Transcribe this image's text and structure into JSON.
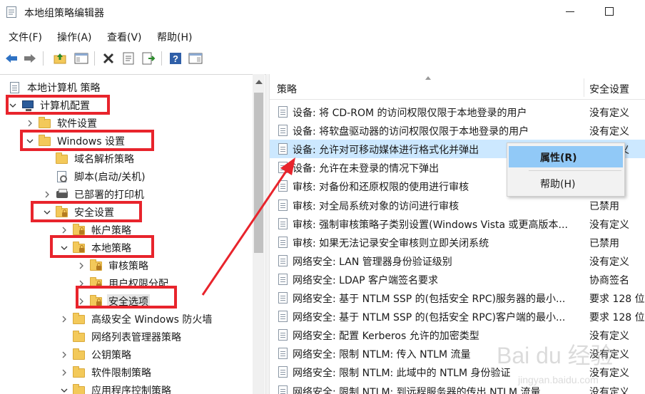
{
  "window": {
    "title": "本地组策略编辑器"
  },
  "menu": [
    "文件(F)",
    "操作(A)",
    "查看(V)",
    "帮助(H)"
  ],
  "toolbar": {
    "buttons": [
      "back-icon",
      "forward-icon",
      "up-folder-icon",
      "show-hide-tree-icon",
      "delete-icon",
      "properties-icon",
      "export-list-icon",
      "help-icon",
      "show-action-pane-icon"
    ]
  },
  "tree": {
    "items": [
      {
        "label": "本地计算机 策略",
        "icon": "document-icon"
      },
      {
        "label": "计算机配置",
        "icon": "computer-icon"
      },
      {
        "label": "软件设置",
        "icon": "folder-icon"
      },
      {
        "label": "Windows 设置",
        "icon": "folder-icon"
      },
      {
        "label": "域名解析策略",
        "icon": "folder-icon"
      },
      {
        "label": "脚本(启动/关机)",
        "icon": "script-icon"
      },
      {
        "label": "已部署的打印机",
        "icon": "printer-icon"
      },
      {
        "label": "安全设置",
        "icon": "security-folder-icon"
      },
      {
        "label": "帐户策略",
        "icon": "security-folder-icon"
      },
      {
        "label": "本地策略",
        "icon": "security-folder-icon"
      },
      {
        "label": "审核策略",
        "icon": "security-folder-icon"
      },
      {
        "label": "用户权限分配",
        "icon": "security-folder-icon"
      },
      {
        "label": "安全选项",
        "icon": "security-folder-icon"
      },
      {
        "label": "高级安全 Windows 防火墙",
        "icon": "folder-icon"
      },
      {
        "label": "网络列表管理器策略",
        "icon": "folder-icon"
      },
      {
        "label": "公钥策略",
        "icon": "folder-icon"
      },
      {
        "label": "软件限制策略",
        "icon": "folder-icon"
      },
      {
        "label": "应用程序控制策略",
        "icon": "folder-icon"
      }
    ]
  },
  "list": {
    "columns": {
      "policy": "策略",
      "setting": "安全设置"
    },
    "rows": [
      {
        "policy": "设备: 将 CD-ROM 的访问权限仅限于本地登录的用户",
        "setting": "没有定义"
      },
      {
        "policy": "设备: 将软盘驱动器的访问权限仅限于本地登录的用户",
        "setting": "没有定义"
      },
      {
        "policy": "设备: 允许对可移动媒体进行格式化并弹出",
        "setting": "没有定义"
      },
      {
        "policy": "设备: 允许在未登录的情况下弹出",
        "setting": ""
      },
      {
        "policy": "审核: 对备份和还原权限的使用进行审核",
        "setting": ""
      },
      {
        "policy": "审核: 对全局系统对象的访问进行审核",
        "setting": "已禁用"
      },
      {
        "policy": "审核: 强制审核策略子类别设置(Windows Vista 或更高版本...",
        "setting": "没有定义"
      },
      {
        "policy": "审核: 如果无法记录安全审核则立即关闭系统",
        "setting": "已禁用"
      },
      {
        "policy": "网络安全: LAN 管理器身份验证级别",
        "setting": "没有定义"
      },
      {
        "policy": "网络安全: LDAP 客户端签名要求",
        "setting": "协商签名"
      },
      {
        "policy": "网络安全: 基于 NTLM SSP 的(包括安全 RPC)服务器的最小...",
        "setting": "要求 128 位"
      },
      {
        "policy": "网络安全: 基于 NTLM SSP 的(包括安全 RPC)客户端的最小...",
        "setting": "要求 128 位"
      },
      {
        "policy": "网络安全: 配置 Kerberos 允许的加密类型",
        "setting": "没有定义"
      },
      {
        "policy": "网络安全: 限制 NTLM: 传入 NTLM 流量",
        "setting": "没有定义"
      },
      {
        "policy": "网络安全: 限制 NTLM: 此域中的 NTLM 身份验证",
        "setting": "没有定义"
      },
      {
        "policy": "网络安全: 限制 NTLM: 到远程服务器的传出 NTLM 流量",
        "setting": "没有定义"
      }
    ]
  },
  "context_menu": {
    "items": [
      {
        "label": "属性(R)",
        "highlighted": true,
        "bold": true
      },
      {
        "label": "帮助(H)",
        "highlighted": false,
        "bold": false
      }
    ]
  },
  "annotations": {
    "color": "#e8242c"
  },
  "watermark": {
    "text": "Bai du 经验",
    "sub": "jingyan.baidu.com"
  },
  "colors": {
    "selection": "#cce8ff",
    "menu_highlight": "#91c9f7"
  }
}
